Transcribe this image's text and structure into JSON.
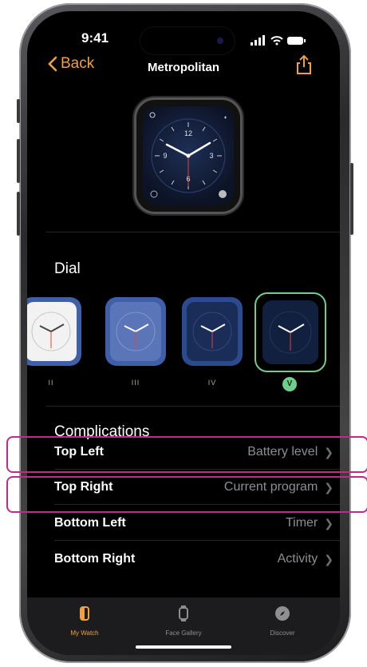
{
  "status": {
    "time": "9:41"
  },
  "nav": {
    "back_label": "Back",
    "title": "Metropolitan"
  },
  "dial": {
    "heading": "Dial",
    "options": [
      {
        "label": "II",
        "bg": "#f2f2f2"
      },
      {
        "label": "III",
        "bg": "#3f5fa8"
      },
      {
        "label": "IV",
        "bg": "#2b4a8f"
      },
      {
        "label": "V",
        "bg": "#12203f"
      }
    ],
    "selected_badge": "V"
  },
  "complications": {
    "heading": "Complications",
    "rows": [
      {
        "label": "Top Left",
        "value": "Battery level"
      },
      {
        "label": "Top Right",
        "value": "Current program"
      },
      {
        "label": "Bottom Left",
        "value": "Timer"
      },
      {
        "label": "Bottom Right",
        "value": "Activity"
      }
    ]
  },
  "tabs": [
    {
      "label": "My Watch",
      "active": true,
      "icon": "watch-icon"
    },
    {
      "label": "Face Gallery",
      "active": false,
      "icon": "face-gallery-icon"
    },
    {
      "label": "Discover",
      "active": false,
      "icon": "compass-icon"
    }
  ],
  "preview": {
    "numerals": [
      "12",
      "3",
      "6",
      "9"
    ]
  },
  "colors": {
    "accent": "#f0a040",
    "selection": "#6fcf8a",
    "highlight": "#c02a8a"
  }
}
